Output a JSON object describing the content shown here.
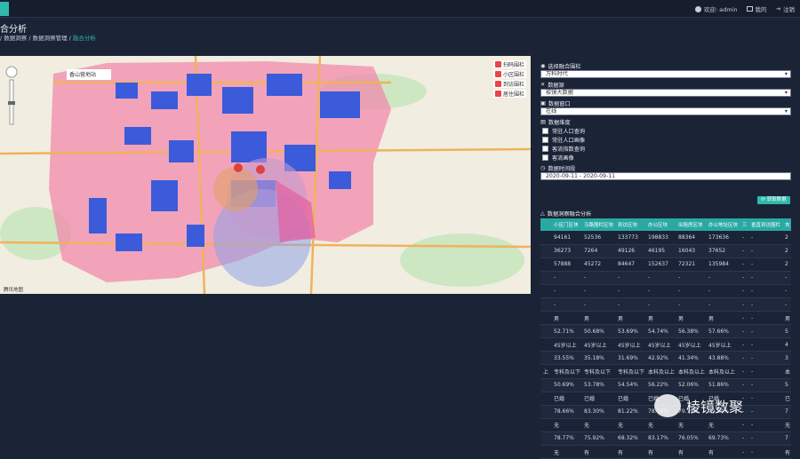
{
  "topbar": {
    "user": "欢迎: admin",
    "mine": "我的",
    "logout": "注销"
  },
  "page": {
    "title": "合分析",
    "breadcrumb": [
      "数据洞察",
      "数据洞察管理",
      "融合分析"
    ]
  },
  "map": {
    "place_label": "香山营地站",
    "legend": [
      "扫码围栏",
      "小区围栏",
      "到访围栏",
      "居住围栏"
    ],
    "attribution": "腾讯地图"
  },
  "panel": {
    "merchant_label": "选择融合围栏",
    "merchant_value": "万科时代",
    "datasource_label": "数据源",
    "datasource_value": "梭镜大数据",
    "window_label": "数据窗口",
    "window_value": "在线",
    "dimension_label": "数据维度",
    "checkboxes": [
      "常驻人口查询",
      "常驻人口画像",
      "客流指数查询",
      "客流画像"
    ],
    "period_label": "数据时间段",
    "period_value": "2020-09-11 - 2020-09-11",
    "button": "获取数据",
    "table_title": "数据洞察融合分析"
  },
  "table": {
    "headers": [
      "",
      "小区门区块",
      "马路围栏区块",
      "到访区块",
      "办公区块",
      "出租房区块",
      "办公地址区块",
      "三",
      "垂直到访围栏",
      "充"
    ],
    "rows": [
      [
        "",
        "94161",
        "52536",
        "133773",
        "198833",
        "88364",
        "173636",
        "-",
        "-",
        "2"
      ],
      [
        "",
        "36273",
        "7264",
        "49126",
        "46195",
        "16043",
        "37652",
        "-",
        "-",
        "2"
      ],
      [
        "",
        "57888",
        "45272",
        "84647",
        "152637",
        "72321",
        "135984",
        "-",
        "-",
        "2"
      ],
      [
        "",
        "-",
        "-",
        "-",
        "-",
        "-",
        "-",
        "-",
        "-",
        "-"
      ],
      [
        "",
        "-",
        "-",
        "-",
        "-",
        "-",
        "-",
        "-",
        "-",
        "-"
      ],
      [
        "",
        "-",
        "-",
        "-",
        "-",
        "-",
        "-",
        "-",
        "-",
        "-"
      ],
      [
        "",
        "男",
        "男",
        "男",
        "男",
        "男",
        "男",
        "-",
        "-",
        "男"
      ],
      [
        "",
        "52.71%",
        "50.68%",
        "53.69%",
        "54.74%",
        "56.38%",
        "57.66%",
        "-",
        "-",
        "5"
      ],
      [
        "",
        "45岁以上",
        "45岁以上",
        "45岁以上",
        "45岁以上",
        "45岁以上",
        "45岁以上",
        "-",
        "-",
        "4"
      ],
      [
        "",
        "33.55%",
        "35.18%",
        "31.69%",
        "42.92%",
        "41.34%",
        "43.88%",
        "-",
        "-",
        "3"
      ],
      [
        "上",
        "专科及以下",
        "专科及以下",
        "专科及以下",
        "本科及以上",
        "本科及以上",
        "本科及以上",
        "-",
        "-",
        "本"
      ],
      [
        "",
        "50.69%",
        "53.78%",
        "54.54%",
        "56.22%",
        "52.06%",
        "51.86%",
        "-",
        "-",
        "5"
      ],
      [
        "",
        "已婚",
        "已婚",
        "已婚",
        "已婚",
        "已婚",
        "已婚",
        "-",
        "-",
        "已"
      ],
      [
        "",
        "78.66%",
        "83.30%",
        "81.22%",
        "78.76%",
        "79.79%",
        "79.24%",
        "-",
        "-",
        "7"
      ],
      [
        "",
        "无",
        "无",
        "无",
        "无",
        "无",
        "无",
        "-",
        "-",
        "无"
      ],
      [
        "",
        "78.77%",
        "75.92%",
        "68.32%",
        "83.17%",
        "76.05%",
        "69.73%",
        "-",
        "-",
        "7"
      ],
      [
        "",
        "无",
        "有",
        "有",
        "有",
        "有",
        "有",
        "-",
        "-",
        "有"
      ]
    ]
  },
  "watermark": "棱镜数聚",
  "colors": {
    "accent": "#2fb8ac",
    "background": "#1b2336",
    "fence_pink": "#f283a8",
    "point_blue": "#3b5bdb"
  }
}
